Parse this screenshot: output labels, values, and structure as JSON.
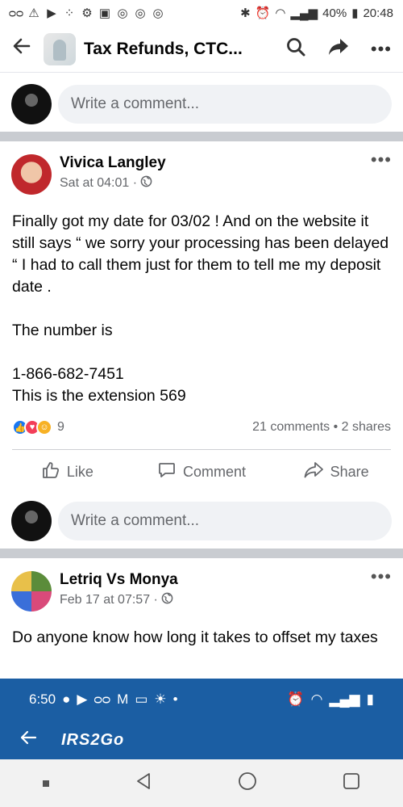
{
  "status_bar": {
    "battery": "40%",
    "time": "20:48"
  },
  "header": {
    "title": "Tax Refunds, CTC..."
  },
  "composer": {
    "placeholder": "Write a comment..."
  },
  "post1": {
    "author": "Vivica Langley",
    "time": "Sat at 04:01 ·",
    "body": "Finally got my date for 03/02 ! And on the website it still says “ we sorry your processing has been delayed “ I had to call them just for them to tell me my deposit date .\n\nThe number is\n\n1-866-682-7451\nThis is the extension  569",
    "reactions_count": "9",
    "comments_shares": "21 comments • 2 shares",
    "actions": {
      "like": "Like",
      "comment": "Comment",
      "share": "Share"
    }
  },
  "post2": {
    "author": "Letriq Vs Monya",
    "time": "Feb 17 at 07:57 ·",
    "body": "Do anyone know how long it takes to offset my taxes"
  },
  "embedded": {
    "time": "6:50",
    "app_title": "IRS2Go"
  },
  "colors": {
    "fb_blue": "#1877f2",
    "irs_blue": "#1b5ea3",
    "divider": "#c9ccd1"
  }
}
